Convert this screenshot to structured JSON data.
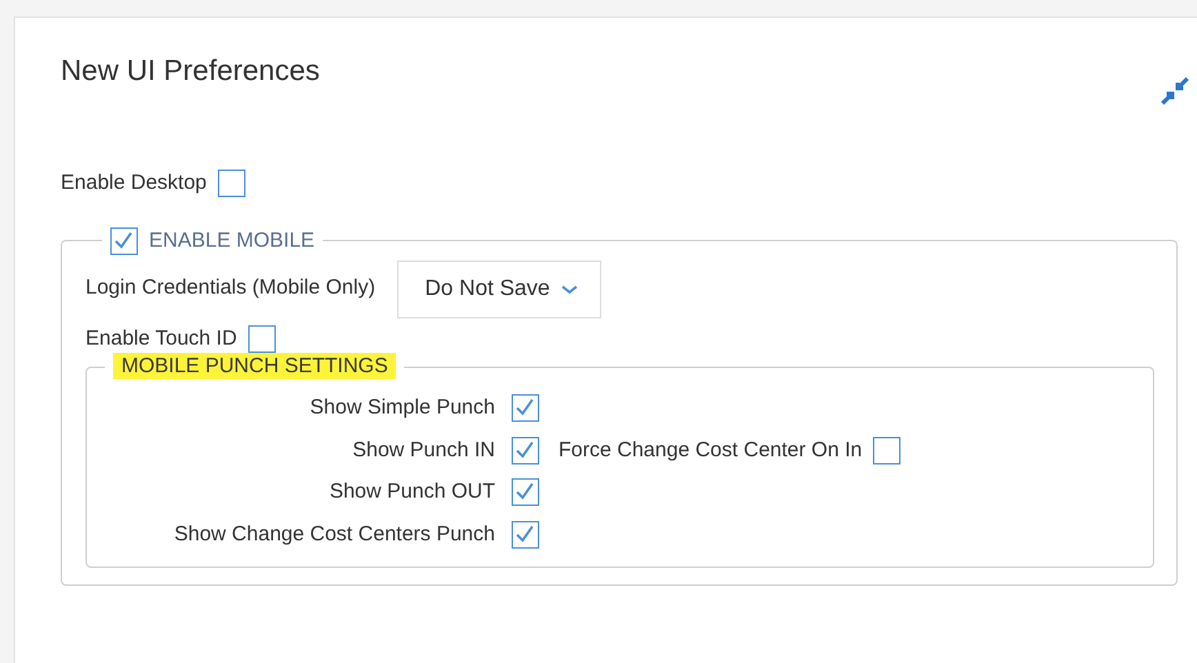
{
  "panel": {
    "title": "New UI Preferences"
  },
  "enable_desktop": {
    "label": "Enable Desktop",
    "checked": false
  },
  "enable_mobile": {
    "label": "ENABLE MOBILE",
    "checked": true,
    "login_credentials": {
      "label": "Login Credentials (Mobile Only)",
      "value": "Do Not Save"
    },
    "enable_touch_id": {
      "label": "Enable Touch ID",
      "checked": false
    },
    "punch_settings": {
      "title": "MOBILE PUNCH SETTINGS",
      "options": [
        {
          "label": "Show Simple Punch",
          "checked": true
        },
        {
          "label": "Show Punch IN",
          "checked": true,
          "extra": {
            "label": "Force Change Cost Center On In",
            "checked": false
          }
        },
        {
          "label": "Show Punch OUT",
          "checked": true
        },
        {
          "label": "Show Change Cost Centers Punch",
          "checked": true
        }
      ]
    }
  }
}
